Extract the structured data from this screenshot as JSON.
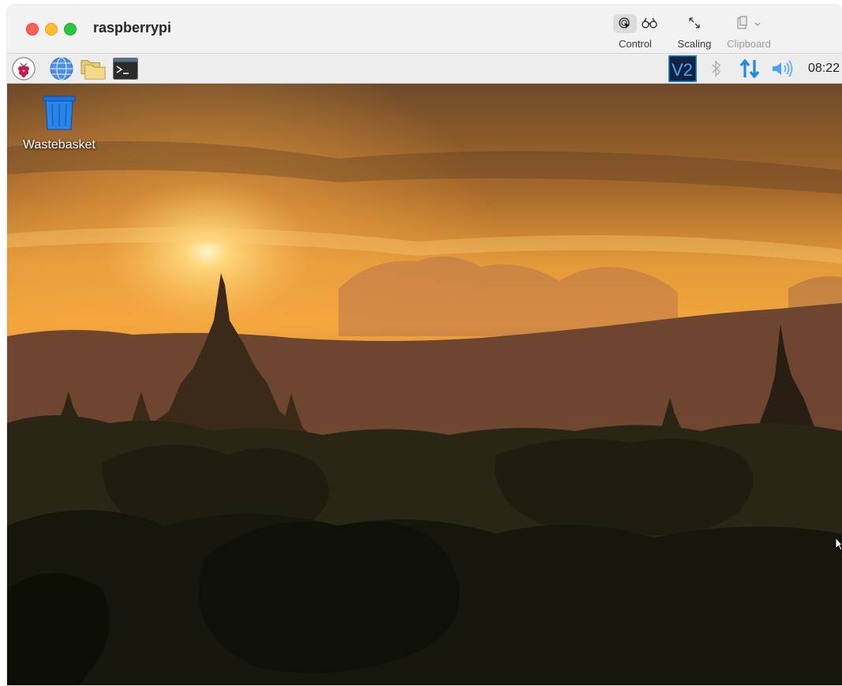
{
  "window": {
    "title": "raspberrypi"
  },
  "toolbar": {
    "control_label": "Control",
    "scaling_label": "Scaling",
    "clipboard_label": "Clipboard"
  },
  "panel": {
    "clock": "08:22",
    "icons": [
      "raspberry-menu-icon",
      "web-browser-icon",
      "file-manager-icon",
      "terminal-icon",
      "vnc-server-icon",
      "bluetooth-icon",
      "network-icon",
      "volume-icon"
    ]
  },
  "desktop": {
    "icons": [
      {
        "label": "Wastebasket",
        "icon": "trash-icon"
      }
    ]
  },
  "colors": {
    "close": "#fe5f57",
    "minimize": "#febc2e",
    "maximize": "#28c840",
    "accent_blue": "#1e88e5",
    "sky_glow": "#f3a63c"
  }
}
